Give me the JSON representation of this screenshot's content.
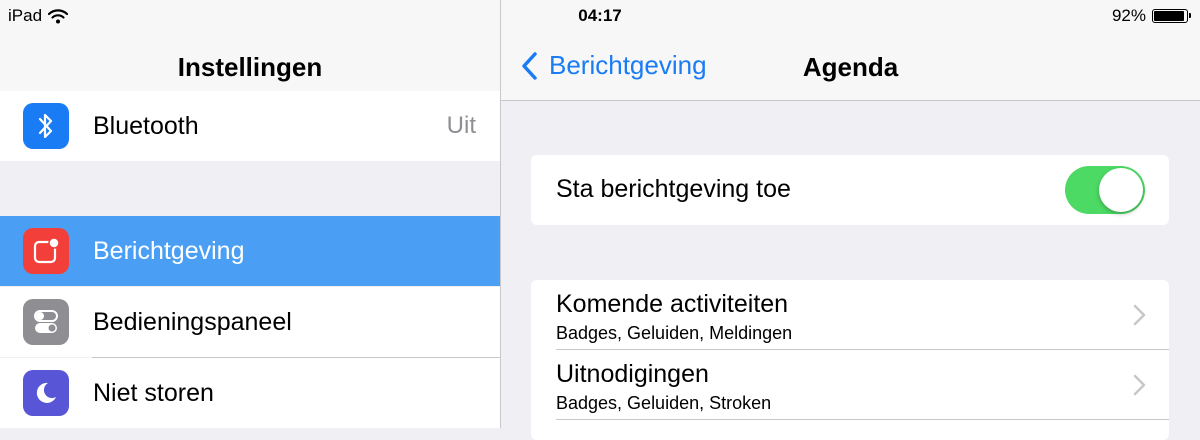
{
  "status_bar": {
    "carrier": "iPad",
    "time": "04:17",
    "battery": "92%"
  },
  "sidebar": {
    "title": "Instellingen",
    "items": [
      {
        "label": "Bluetooth",
        "value": "Uit",
        "icon": "bluetooth-icon",
        "color": "#1a7cf5"
      },
      {
        "label": "Berichtgeving",
        "icon": "notifications-icon",
        "color": "#f23f3a",
        "selected": true
      },
      {
        "label": "Bedieningspaneel",
        "icon": "control-center-icon",
        "color": "#8e8e93"
      },
      {
        "label": "Niet storen",
        "icon": "moon-icon",
        "color": "#5856d6"
      }
    ]
  },
  "detail": {
    "back_label": "Berichtgeving",
    "title": "Agenda",
    "allow_label": "Sta berichtgeving toe",
    "allow_enabled": true,
    "rows": [
      {
        "title": "Komende activiteiten",
        "subtitle": "Badges, Geluiden, Meldingen"
      },
      {
        "title": "Uitnodigingen",
        "subtitle": "Badges, Geluiden, Stroken"
      }
    ]
  },
  "colors": {
    "accent": "#1a7cf5",
    "selected_row": "#4a9ff5",
    "switch_on": "#4cd964",
    "background": "#efeff4"
  }
}
